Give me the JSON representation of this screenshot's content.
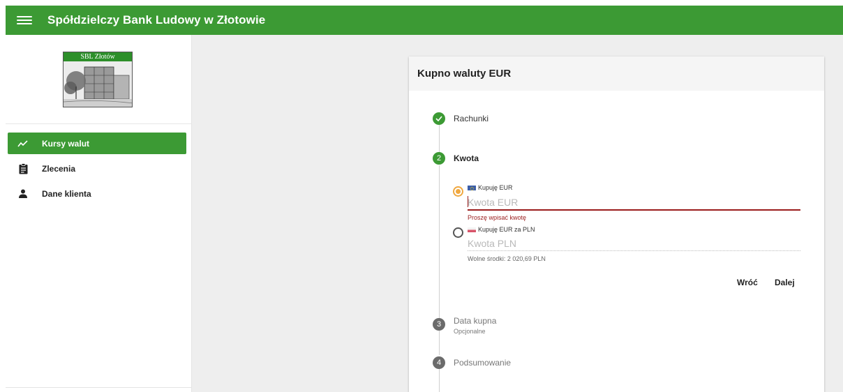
{
  "header": {
    "title": "Spółdzielczy Bank Ludowy w Złotowie",
    "menu_icon": "hamburger-menu-icon",
    "background_color": "#3c9a34"
  },
  "sidebar": {
    "logo_text": "SBL Złotów",
    "items": [
      {
        "label": "Kursy walut",
        "icon": "trending-up-icon",
        "active": true
      },
      {
        "label": "Zlecenia",
        "icon": "clipboard-icon",
        "active": false
      },
      {
        "label": "Dane klienta",
        "icon": "person-icon",
        "active": false
      }
    ]
  },
  "card": {
    "title": "Kupno waluty EUR",
    "steps": [
      {
        "number": "",
        "label": "Rachunki",
        "state": "completed",
        "icon": "check-icon"
      },
      {
        "number": "2",
        "label": "Kwota",
        "state": "active"
      },
      {
        "number": "3",
        "label": "Data kupna",
        "sublabel": "Opcjonalne",
        "state": "pending"
      },
      {
        "number": "4",
        "label": "Podsumowanie",
        "state": "pending"
      }
    ],
    "form": {
      "option_eur": {
        "label": "Kupuję EUR",
        "placeholder": "Kwota EUR",
        "value": "",
        "selected": true,
        "flag_icon": "eu-flag-icon"
      },
      "error": "Proszę wpisać kwotę",
      "option_pln": {
        "label": "Kupuję EUR za PLN",
        "placeholder": "Kwota PLN",
        "value": "",
        "selected": false,
        "flag_icon": "pl-flag-icon"
      },
      "available_funds": "Wolne środki: 2 020,69 PLN",
      "back_label": "Wróć",
      "next_label": "Dalej"
    }
  },
  "colors": {
    "primary_green": "#3c9a34",
    "error_red": "#9a1c1c",
    "radio_accent": "#f0a840"
  }
}
